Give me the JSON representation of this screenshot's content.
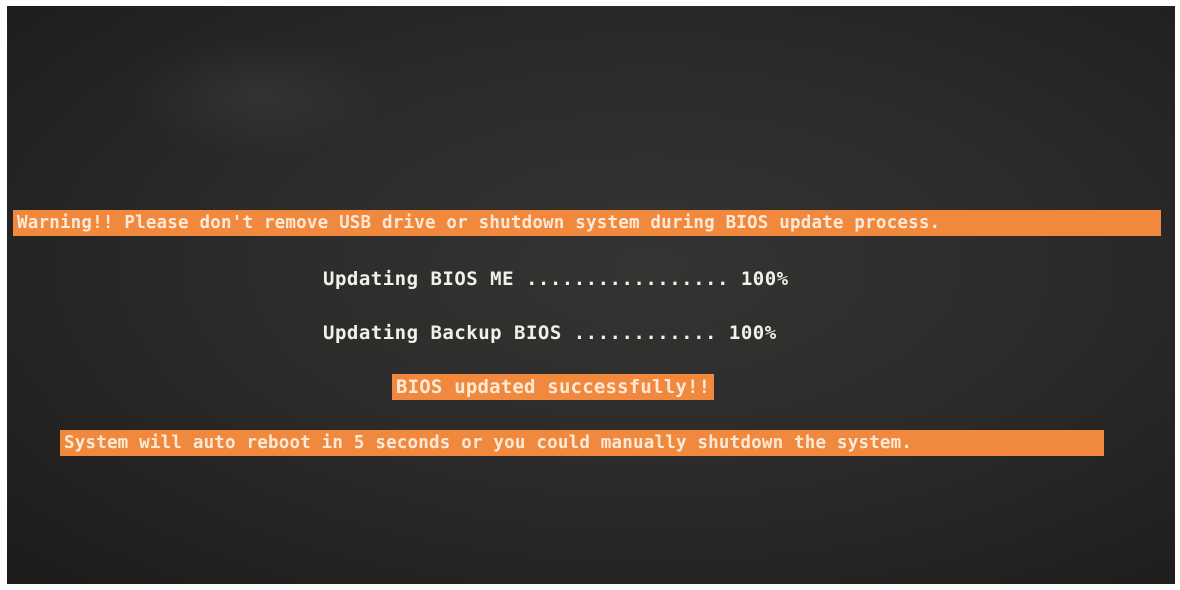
{
  "screen": {
    "warning_text": "Warning!! Please don't remove USB drive or shutdown system during BIOS update process.",
    "progress_rows": [
      {
        "text": "Updating BIOS ME ................. 100%",
        "percent": 100
      },
      {
        "text": "Updating Backup BIOS ............ 100%",
        "percent": 100
      }
    ],
    "success_text": "BIOS updated successfully!!",
    "reboot_text": "System will auto reboot in 5 seconds or you could manually shutdown the system."
  },
  "colors": {
    "highlight": "#f0893e",
    "background": "#2c2b29",
    "text": "#f2f0ec"
  }
}
